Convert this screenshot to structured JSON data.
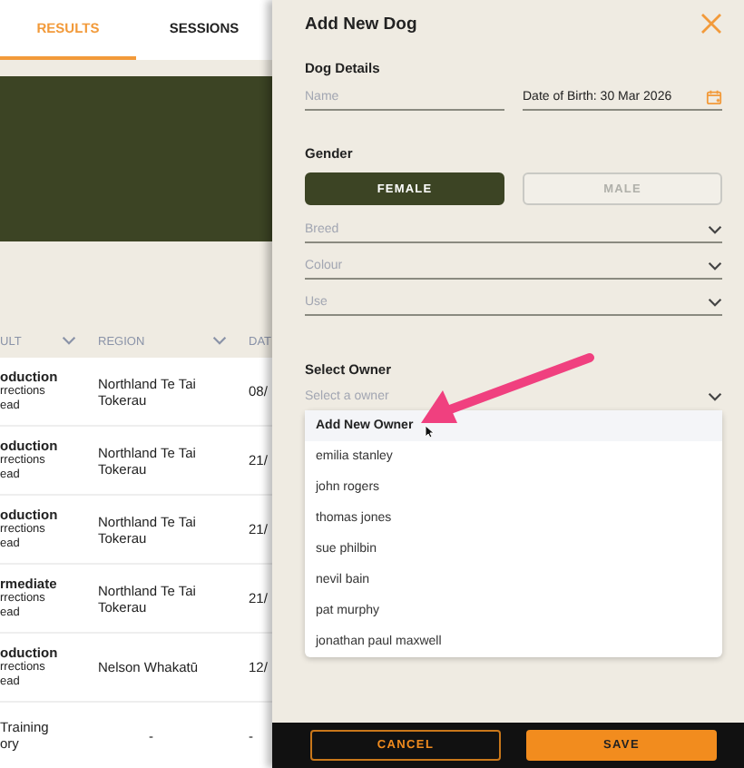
{
  "tabs": [
    {
      "label": "RESULTS",
      "selected": true
    },
    {
      "label": "SESSIONS",
      "selected": false
    }
  ],
  "table": {
    "columns": [
      "ULT",
      "REGION",
      "DAT"
    ],
    "rows": [
      {
        "title": "oduction",
        "lines": [
          "rrections",
          "ead"
        ],
        "region": "Northland Te Tai Tokerau",
        "date": "08/"
      },
      {
        "title": "oduction",
        "lines": [
          "rrections",
          "ead"
        ],
        "region": "Northland Te Tai Tokerau",
        "date": "21/"
      },
      {
        "title": "oduction",
        "lines": [
          "rrections",
          "ead"
        ],
        "region": "Northland Te Tai Tokerau",
        "date": "21/"
      },
      {
        "title": "rmediate",
        "lines": [
          "rrections",
          "ead"
        ],
        "region": "Northland Te Tai Tokerau",
        "date": "21/"
      },
      {
        "title": "oduction",
        "lines": [
          "rrections",
          "ead"
        ],
        "region": "Nelson Whakatū",
        "date": "12/"
      },
      {
        "lines": [
          "Training",
          "ory"
        ],
        "region": "-",
        "date": "-"
      }
    ]
  },
  "drawer": {
    "title": "Add New Dog",
    "dog_details": {
      "heading": "Dog Details",
      "name": {
        "placeholder": "Name"
      },
      "date_of_birth": {
        "label": "Date of Birth:",
        "value": "30 Mar 2026"
      }
    },
    "gender": {
      "heading": "Gender",
      "options": [
        {
          "label": "FEMALE",
          "selected": true
        },
        {
          "label": "MALE",
          "selected": false
        }
      ]
    },
    "selects": [
      {
        "placeholder": "Breed"
      },
      {
        "placeholder": "Colour"
      },
      {
        "placeholder": "Use"
      }
    ],
    "owner": {
      "heading": "Select Owner",
      "placeholder": "Select a owner",
      "expanded": true,
      "options": [
        {
          "label": "Add New Owner",
          "kind": "action",
          "selected": true
        },
        {
          "label": "emilia stanley",
          "kind": "owner",
          "selected": false
        },
        {
          "label": "john rogers",
          "kind": "owner",
          "selected": false
        },
        {
          "label": "thomas jones",
          "kind": "owner",
          "selected": false
        },
        {
          "label": "sue philbin",
          "kind": "owner",
          "selected": false
        },
        {
          "label": "nevil bain",
          "kind": "owner",
          "selected": false
        },
        {
          "label": "pat murphy",
          "kind": "owner",
          "selected": false
        },
        {
          "label": "jonathan paul maxwell",
          "kind": "owner",
          "selected": false
        }
      ]
    },
    "buttons": [
      {
        "label": "CANCEL",
        "kind": "secondary"
      },
      {
        "label": "SAVE",
        "kind": "primary"
      }
    ]
  }
}
